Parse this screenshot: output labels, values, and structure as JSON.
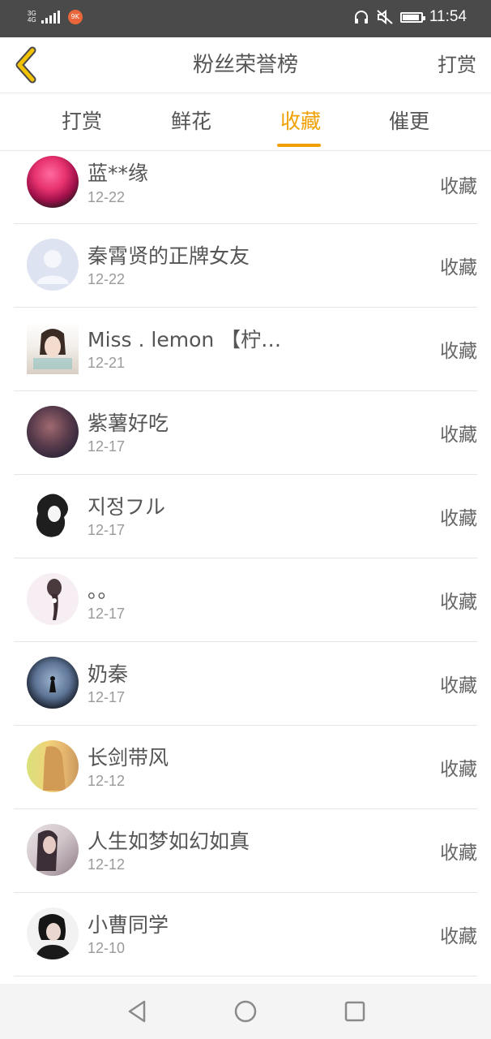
{
  "status_bar": {
    "network": "3G",
    "network_sub": "4G",
    "app_badge": "9K",
    "time": "11:54",
    "icons": [
      "signal-icon",
      "app-notification-icon",
      "headset-icon",
      "mute-icon",
      "battery-icon"
    ]
  },
  "header": {
    "title": "粉丝荣誉榜",
    "action": "打赏",
    "back_icon": "chevron-left-icon"
  },
  "tabs": [
    {
      "label": "打赏"
    },
    {
      "label": "鲜花"
    },
    {
      "label": "收藏",
      "active": true
    },
    {
      "label": "催更"
    }
  ],
  "colors": {
    "accent": "#f0a000",
    "status_bar": "#4a4a4a"
  },
  "list": [
    {
      "name": "蓝**缘",
      "date": "12-22",
      "action": "收藏"
    },
    {
      "name": "秦霄贤的正牌女友",
      "date": "12-22",
      "action": "收藏"
    },
    {
      "name": "Miss . lemon 【柠…",
      "date": "12-21",
      "action": "收藏"
    },
    {
      "name": "紫薯好吃",
      "date": "12-17",
      "action": "收藏"
    },
    {
      "name": "지정フル",
      "date": "12-17",
      "action": "收藏"
    },
    {
      "name": "。。",
      "date": "12-17",
      "action": "收藏"
    },
    {
      "name": "奶秦",
      "date": "12-17",
      "action": "收藏"
    },
    {
      "name": "长剑带风",
      "date": "12-12",
      "action": "收藏"
    },
    {
      "name": "人生如梦如幻如真",
      "date": "12-12",
      "action": "收藏"
    },
    {
      "name": "小曹同学",
      "date": "12-10",
      "action": "收藏"
    }
  ],
  "nav_bar": {
    "icons": [
      "back-triangle-icon",
      "home-circle-icon",
      "recents-square-icon"
    ]
  }
}
